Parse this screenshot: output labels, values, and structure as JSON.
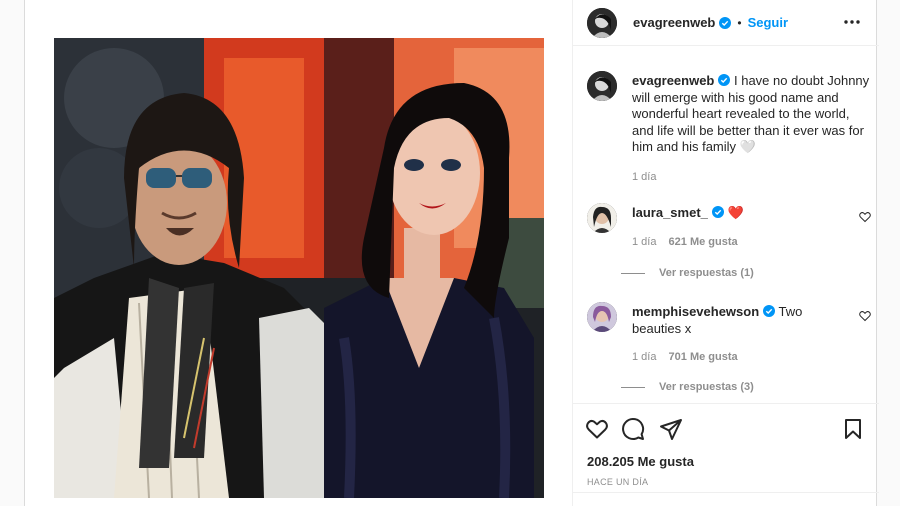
{
  "post": {
    "author": "evagreenweb",
    "follow_label": "Seguir",
    "dot": "•",
    "caption": "I have no doubt Johnny will emerge with his good name and wonderful heart revealed to the world, and life will be better than it ever was for him and his family 🤍",
    "caption_age": "1 día"
  },
  "comments": [
    {
      "user": "laura_smet_",
      "text": "❤️",
      "age": "1 día",
      "likes": "621 Me gusta",
      "replies": "Ver respuestas (1)"
    },
    {
      "user": "memphisevehewson",
      "text": "Two beauties x",
      "age": "1 día",
      "likes": "701 Me gusta",
      "replies": "Ver respuestas (3)"
    }
  ],
  "footer": {
    "likes": "208.205 Me gusta",
    "time": "HACE UN DÍA"
  },
  "icons": {
    "like": "heart-outline-icon",
    "comment": "speech-bubble-icon",
    "share": "paper-plane-icon",
    "save": "bookmark-icon",
    "verified": "verified-badge-icon",
    "more": "ellipsis-icon"
  },
  "colors": {
    "accent": "#0095f6",
    "heart_red": "#ed4956",
    "muted": "#8e8e8e"
  }
}
